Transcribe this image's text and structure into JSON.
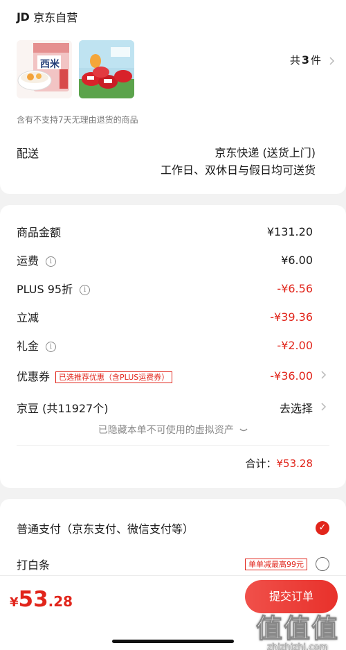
{
  "store": {
    "logo": "JD",
    "name": "京东自营",
    "count_prefix": "共",
    "count_value": "3",
    "count_suffix": "件",
    "product_1_text": "西米",
    "notice": "含有不支持7天无理由退货的商品",
    "shipping_label": "配送",
    "shipping_line1": "京东快递 (送货上门)",
    "shipping_line2": "工作日、双休日与假日均可送货"
  },
  "prices": {
    "rows": [
      {
        "label": "商品金额",
        "value": "¥131.20",
        "info": false,
        "red": false
      },
      {
        "label": "运费",
        "value": "¥6.00",
        "info": true,
        "red": false
      },
      {
        "label": "PLUS 95折",
        "value": "-¥6.56",
        "info": true,
        "red": true
      },
      {
        "label": "立减",
        "value": "-¥39.36",
        "info": false,
        "red": true
      },
      {
        "label": "礼金",
        "value": "-¥2.00",
        "info": true,
        "red": true
      }
    ],
    "coupon_label": "优惠券",
    "coupon_tag": "已选推荐优惠（含PLUS运费券）",
    "coupon_value": "-¥36.00",
    "beans_label": "京豆 (共11927个)",
    "beans_action": "去选择",
    "hidden_note": "已隐藏本单不可使用的虚拟资产",
    "total_label": "合计：",
    "total_value": "¥53.28"
  },
  "payment": {
    "option1": "普通支付（京东支付、微信支付等）",
    "option2": "打白条",
    "option2_tag": "单单减最高99元"
  },
  "bottom": {
    "currency": "¥",
    "price_int": "53",
    "price_dec": ".28",
    "submit_label": "提交订单"
  },
  "watermark": {
    "big": "值值值",
    "small": "zhizhizhi.com"
  },
  "colors": {
    "accent": "#e1251b",
    "background": "#f2f2f2"
  }
}
